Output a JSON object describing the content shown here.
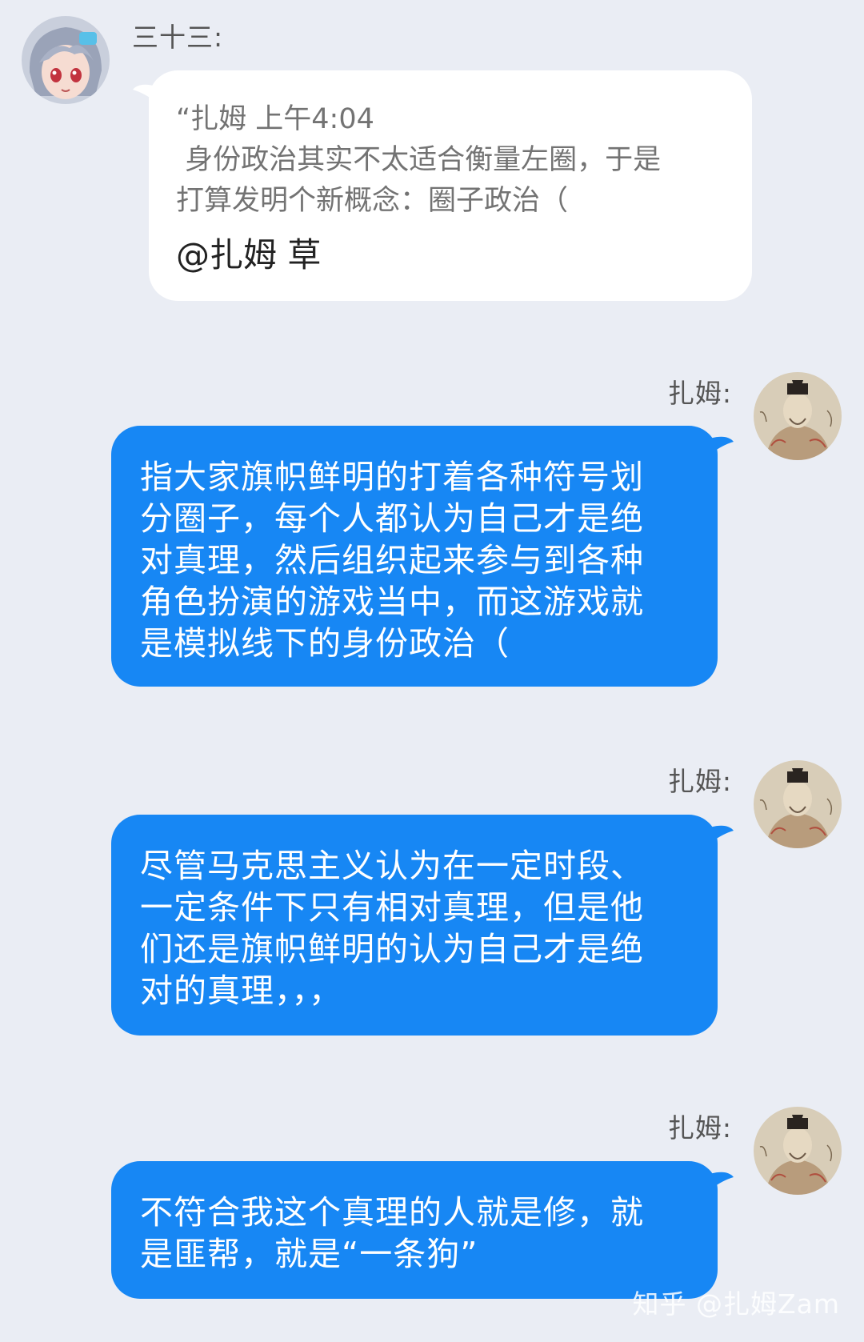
{
  "messages": [
    {
      "sender": "三十三:",
      "side": "left",
      "quote_lines": [
        "“扎姆 上午4:04",
        " 身份政治其实不太适合衡量左圈，于是",
        "打算发明个新概念：圈子政治（"
      ],
      "reply": "@扎姆 草"
    },
    {
      "sender": "扎姆:",
      "side": "right",
      "lines": [
        "指大家旗帜鲜明的打着各种符号划",
        "分圈子，每个人都认为自己才是绝",
        "对真理，然后组织起来参与到各种",
        "角色扮演的游戏当中，而这游戏就",
        "是模拟线下的身份政治（"
      ]
    },
    {
      "sender": "扎姆:",
      "side": "right",
      "lines": [
        "尽管马克思主义认为在一定时段、",
        "一定条件下只有相对真理，但是他",
        "们还是旗帜鲜明的认为自己才是绝",
        "对的真理，，，"
      ]
    },
    {
      "sender": "扎姆:",
      "side": "right",
      "lines": [
        "不符合我这个真理的人就是修，就",
        "是匪帮，就是“一条狗”"
      ]
    }
  ],
  "watermark": "知乎 @扎姆Zam",
  "colors": {
    "background": "#eaedf4",
    "bubble_blue": "#1787f4",
    "bubble_white": "#ffffff"
  },
  "icons": {
    "left_avatar": "anime-girl-avatar",
    "right_avatar": "portrait-painting-avatar"
  }
}
